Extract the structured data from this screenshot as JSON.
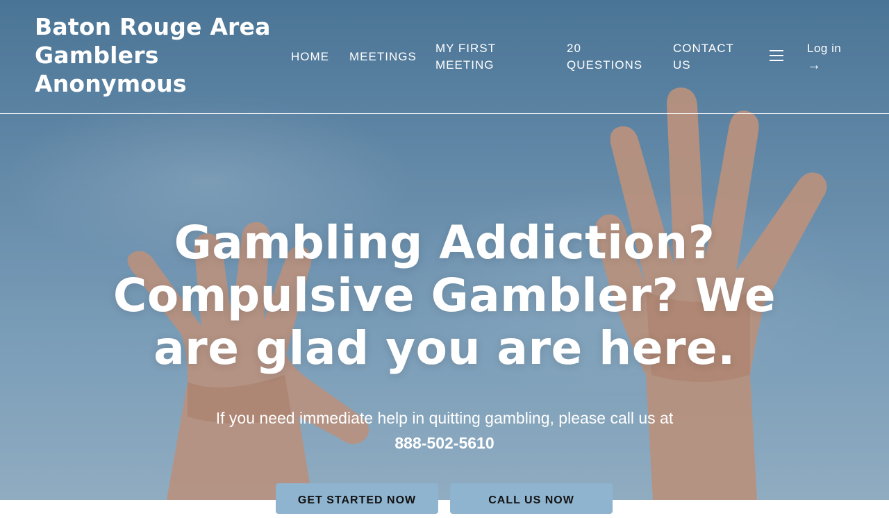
{
  "site": {
    "title": "Baton Rouge Area Gamblers Anonymous"
  },
  "nav": {
    "items": [
      "HOME",
      "MEETINGS",
      "MY FIRST MEETING",
      "20 QUESTIONS",
      "CONTACT US"
    ],
    "menu_icon": "hamburger-menu-icon",
    "login_label": "Log in",
    "login_arrow": "→"
  },
  "hero": {
    "headline": "Gambling Addiction? Compulsive Gambler? We are glad you are here.",
    "subtext": "If you need immediate help in quitting gambling, please call us at",
    "phone": "888-502-5610",
    "buttons": [
      "GET STARTED NOW",
      "CALL US NOW"
    ]
  },
  "colors": {
    "button_bg": "#8fb4cf",
    "sky": "#6b92b1"
  }
}
